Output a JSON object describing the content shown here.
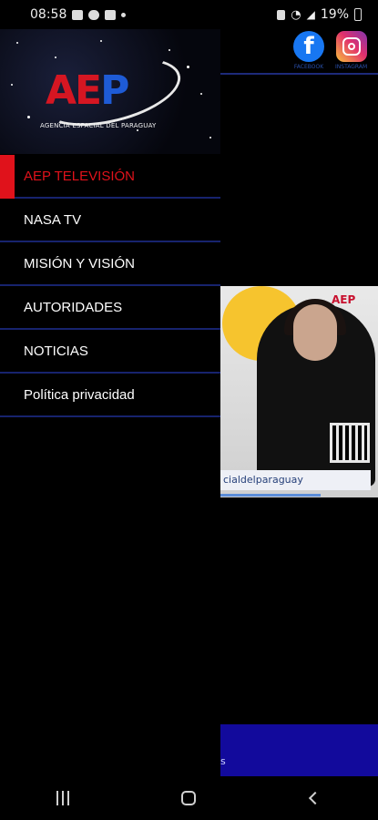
{
  "status_bar": {
    "time": "08:58",
    "battery_percent": "19%",
    "icons_left": [
      "image-icon",
      "cloud-icon",
      "youtube-icon",
      "dot-icon"
    ],
    "icons_right": [
      "lock-icon",
      "wifi-icon",
      "signal-icon",
      "battery-icon"
    ]
  },
  "header": {
    "logo_text": "AEP",
    "logo_subtitle": "AGENCIA ESPACIAL DEL PARAGUAY"
  },
  "social": {
    "facebook_label": "FACEBOOK",
    "instagram_label": "INSTAGRAM"
  },
  "menu": {
    "items": [
      {
        "label": "AEP TELEVISIÓN",
        "active": true
      },
      {
        "label": "NASA TV"
      },
      {
        "label": "MISIÓN Y VISIÓN"
      },
      {
        "label": "AUTORIDADES"
      },
      {
        "label": "NOTICIAS"
      },
      {
        "label": "Política privacidad"
      }
    ]
  },
  "background_content": {
    "video_caption": "cialdelparaguay",
    "banner_fragment": "s"
  },
  "colors": {
    "accent_red": "#e0121b",
    "divider_blue": "#17236e",
    "banner_blue": "#120a9c"
  }
}
